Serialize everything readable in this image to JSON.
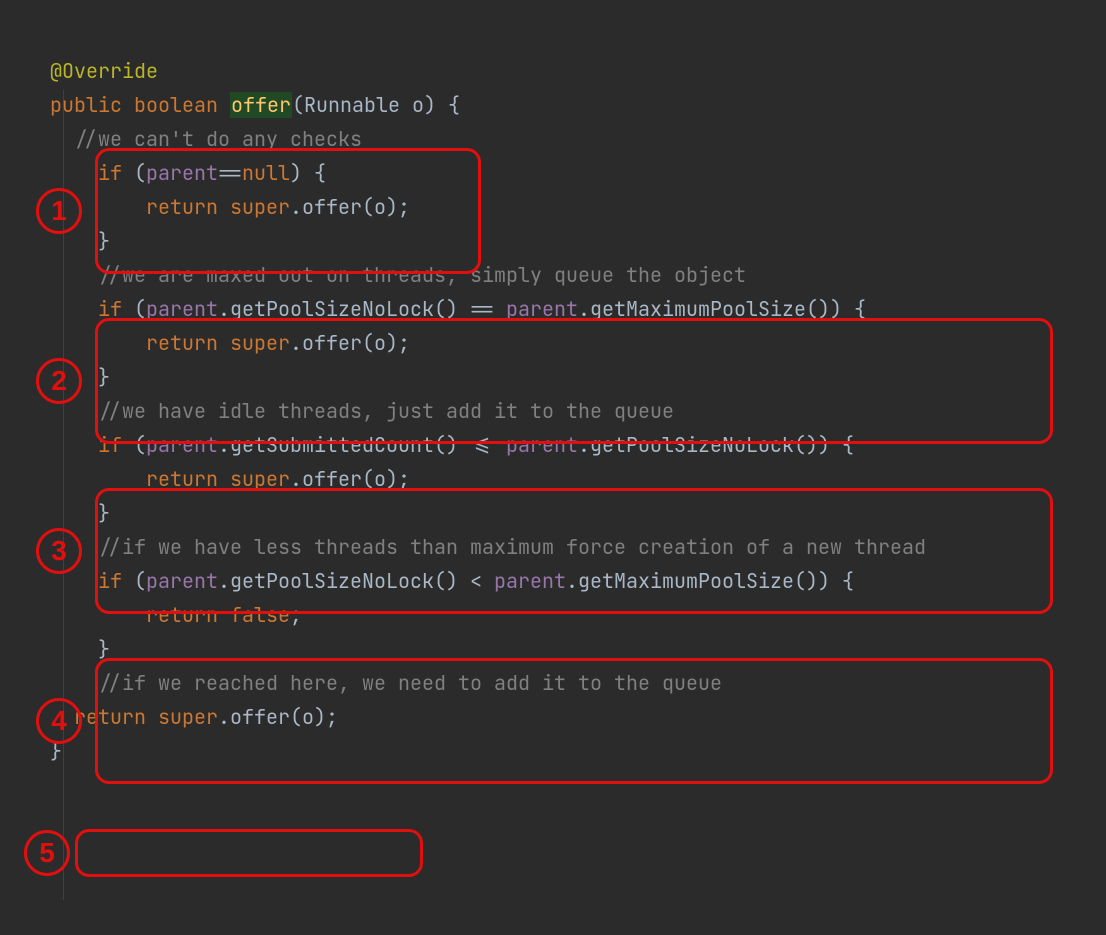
{
  "code": {
    "l1": {
      "ann": "@Override"
    },
    "l2": {
      "kw1": "public",
      "kw2": "boolean",
      "fn": "offer",
      "lp": "(",
      "type": "Runnable",
      "arg": " o",
      "tail": ") {"
    },
    "l3": {
      "cm": "//we can't do any checks"
    },
    "l4": {
      "kw": "if",
      "lp": " (",
      "f": "parent",
      "op": "==",
      "nul": "null",
      "tail": ") {"
    },
    "l5": {
      "kw": "return",
      "sp": " ",
      "sup": "super",
      "dot": ".",
      "call": "offer(o);"
    },
    "l6": {
      "brace": "}"
    },
    "l7": {
      "cm": "//we are maxed out on threads, simply queue the object"
    },
    "l8": {
      "kw": "if",
      "lp": " (",
      "f1": "parent",
      "m1": ".getPoolSizeNoLock() == ",
      "f2": "parent",
      "m2": ".getMaximumPoolSize()) {"
    },
    "l9": {
      "kw": "return",
      "sup": " super",
      "tail": ".offer(o);"
    },
    "l10": {
      "brace": "}"
    },
    "l11": {
      "cm": "//we have idle threads, just add it to the queue"
    },
    "l12": {
      "kw": "if",
      "lp": " (",
      "f1": "parent",
      "m1": ".getSubmittedCount() <= ",
      "f2": "parent",
      "m2": ".getPoolSizeNoLock()) {"
    },
    "l13": {
      "kw": "return",
      "sup": " super",
      "tail": ".offer(o);"
    },
    "l14": {
      "brace": "}"
    },
    "l15": {
      "cm": "//if we have less threads than maximum force creation of a new thread"
    },
    "l16": {
      "kw": "if",
      "lp": " (",
      "f1": "parent",
      "m1": ".getPoolSizeNoLock() < ",
      "f2": "parent",
      "m2": ".getMaximumPoolSize()) {"
    },
    "l17": {
      "kw": "return",
      "val": " false",
      "semi": ";"
    },
    "l18": {
      "brace": "}"
    },
    "l19": {
      "cm": "//if we reached here, we need to add it to the queue"
    },
    "l20": {
      "kw": "return",
      "sup": " super",
      "tail": ".offer(o);"
    },
    "l21": {
      "brace": "}"
    }
  },
  "labels": {
    "n1": "1",
    "n2": "2",
    "n3": "3",
    "n4": "4",
    "n5": "5"
  }
}
